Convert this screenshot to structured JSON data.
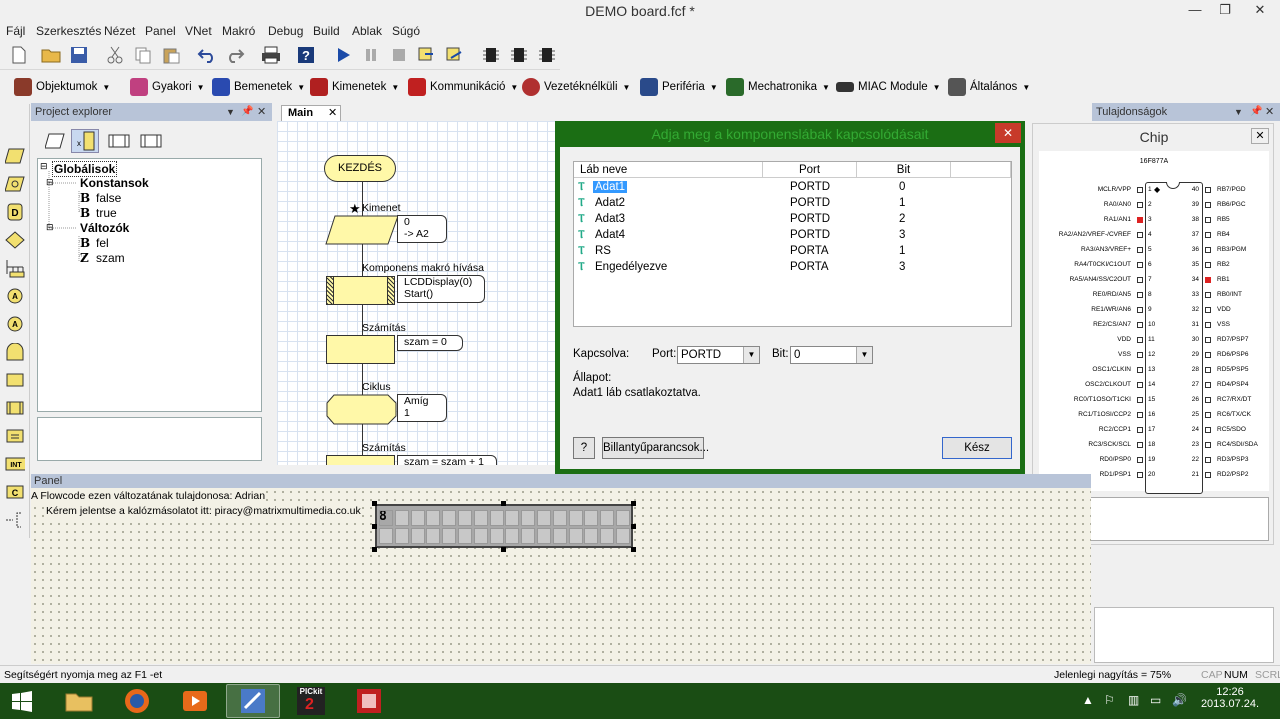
{
  "window": {
    "title": "DEMO board.fcf *",
    "controls": [
      "—",
      "❐",
      "✕"
    ]
  },
  "menu": [
    "Fájl",
    "Szerkesztés",
    "Nézet",
    "Panel",
    "VNet",
    "Makró",
    "Debug",
    "Build",
    "Ablak",
    "Súgó"
  ],
  "toolbar2": [
    "Objektumok",
    "Gyakori",
    "Bemenetek",
    "Kimenetek",
    "Kommunikáció",
    "Vezetéknélküli",
    "Periféria",
    "Mechatronika",
    "MIAC Module",
    "Általános"
  ],
  "project_explorer": {
    "title": "Project explorer",
    "tree": {
      "root": "Globálisok",
      "constants_label": "Konstansok",
      "constants": [
        "false",
        "true"
      ],
      "variables_label": "Változók",
      "variables": [
        "fel",
        "szam"
      ],
      "var_types": [
        "B",
        "Z"
      ],
      "const_types": [
        "B",
        "B"
      ]
    }
  },
  "flowchart": {
    "tab": "Main",
    "start": "KEZDÉS",
    "steps": [
      {
        "label": "Kimenet",
        "comment": [
          "0",
          "-> A2"
        ]
      },
      {
        "label": "Komponens makró hívása",
        "comment": [
          "LCDDisplay(0)",
          "Start()"
        ]
      },
      {
        "label": "Számítás",
        "comment": [
          "szam = 0"
        ]
      },
      {
        "label": "Ciklus",
        "comment": [
          "Amíg",
          "1"
        ]
      },
      {
        "label": "Számítás",
        "comment": [
          "szam = szam + 1"
        ]
      }
    ]
  },
  "dialog": {
    "title": "Adja meg a komponenslábak kapcsolódásait",
    "columns": [
      "Láb neve",
      "Port",
      "Bit"
    ],
    "rows": [
      {
        "name": "Adat1",
        "port": "PORTD",
        "bit": "0",
        "selected": true
      },
      {
        "name": "Adat2",
        "port": "PORTD",
        "bit": "1"
      },
      {
        "name": "Adat3",
        "port": "PORTD",
        "bit": "2"
      },
      {
        "name": "Adat4",
        "port": "PORTD",
        "bit": "3"
      },
      {
        "name": "RS",
        "port": "PORTA",
        "bit": "1"
      },
      {
        "name": "Engedélyezve",
        "port": "PORTA",
        "bit": "3"
      }
    ],
    "connected_label": "Kapcsolva:",
    "port_label": "Port:",
    "port_value": "PORTD",
    "bit_label": "Bit:",
    "bit_value": "0",
    "status_label": "Állapot:",
    "status_text": "Adat1 láb csatlakoztatva.",
    "help_button": "?",
    "shortcuts_button": "Billantyűparancsok...",
    "done_button": "Kész"
  },
  "properties": {
    "title": "Tulajdonságok",
    "chip_title": "Chip",
    "chip_name": "16F877A",
    "pins_left": [
      [
        "MCLR/VPP",
        "1"
      ],
      [
        "RA0/AN0",
        "2"
      ],
      [
        "RA1/AN1",
        "3"
      ],
      [
        "RA2/AN2/VREF-/CVREF",
        "4"
      ],
      [
        "RA3/AN3/VREF+",
        "5"
      ],
      [
        "RA4/T0CKI/C1OUT",
        "6"
      ],
      [
        "RA5/AN4/SS/C2OUT",
        "7"
      ],
      [
        "RE0/RD/AN5",
        "8"
      ],
      [
        "RE1/WR/AN6",
        "9"
      ],
      [
        "RE2/CS/AN7",
        "10"
      ],
      [
        "VDD",
        "11"
      ],
      [
        "VSS",
        "12"
      ],
      [
        "OSC1/CLKIN",
        "13"
      ],
      [
        "OSC2/CLKOUT",
        "14"
      ],
      [
        "RC0/T1OSO/T1CKI",
        "15"
      ],
      [
        "RC1/T1OSI/CCP2",
        "16"
      ],
      [
        "RC2/CCP1",
        "17"
      ],
      [
        "RC3/SCK/SCL",
        "18"
      ],
      [
        "RD0/PSP0",
        "19"
      ],
      [
        "RD1/PSP1",
        "20"
      ]
    ],
    "pins_right": [
      [
        "40",
        "RB7/PGD"
      ],
      [
        "39",
        "RB6/PGC"
      ],
      [
        "38",
        "RB5"
      ],
      [
        "37",
        "RB4"
      ],
      [
        "36",
        "RB3/PGM"
      ],
      [
        "35",
        "RB2"
      ],
      [
        "34",
        "RB1"
      ],
      [
        "33",
        "RB0/INT"
      ],
      [
        "32",
        "VDD"
      ],
      [
        "31",
        "VSS"
      ],
      [
        "30",
        "RD7/PSP7"
      ],
      [
        "29",
        "RD6/PSP6"
      ],
      [
        "28",
        "RD5/PSP5"
      ],
      [
        "27",
        "RD4/PSP4"
      ],
      [
        "26",
        "RC7/RX/DT"
      ],
      [
        "25",
        "RC6/TX/CK"
      ],
      [
        "24",
        "RC5/SDO"
      ],
      [
        "23",
        "RC4/SDI/SDA"
      ],
      [
        "22",
        "RD3/PSP3"
      ],
      [
        "21",
        "RD2/PSP2"
      ]
    ],
    "active_pins_left": [
      "3"
    ],
    "active_pins_right": [
      "34"
    ]
  },
  "panel": {
    "title": "Panel",
    "owner_line": "A Flowcode ezen változatának tulajdonosa: Adrian",
    "piracy_line": "Kérem jelentse a kalózmásolatot itt: piracy@matrixmultimedia.co.uk",
    "lcd_char": "8"
  },
  "statusbar": {
    "help": "Segítségért nyomja meg az F1 -et",
    "zoom": "Jelenlegi nagyítás = 75%",
    "caps": "CAP",
    "num": "NUM",
    "scroll": "SCRL"
  },
  "taskbar": {
    "time": "12:26",
    "date": "2013.07.24.",
    "pickit_label": "PICkit"
  }
}
